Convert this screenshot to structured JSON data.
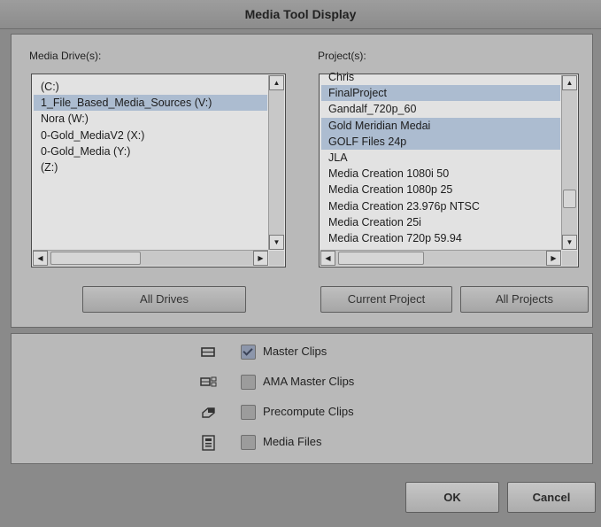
{
  "window": {
    "title": "Media Tool Display"
  },
  "drives": {
    "label": "Media Drive(s):",
    "items": [
      {
        "label": "(C:)",
        "selected": false
      },
      {
        "label": "1_File_Based_Media_Sources (V:)",
        "selected": true
      },
      {
        "label": "Nora (W:)",
        "selected": false
      },
      {
        "label": "0-Gold_MediaV2 (X:)",
        "selected": false
      },
      {
        "label": "0-Gold_Media (Y:)",
        "selected": false
      },
      {
        "label": "(Z:)",
        "selected": false
      }
    ],
    "all_button": "All Drives"
  },
  "projects": {
    "label": "Project(s):",
    "items": [
      {
        "label": "Chris",
        "selected": false
      },
      {
        "label": "FinalProject",
        "selected": true
      },
      {
        "label": "Gandalf_720p_60",
        "selected": false
      },
      {
        "label": "Gold Meridian Medai",
        "selected": true
      },
      {
        "label": "GOLF Files 24p",
        "selected": true
      },
      {
        "label": "JLA",
        "selected": false
      },
      {
        "label": "Media Creation 1080i 50",
        "selected": false
      },
      {
        "label": "Media Creation 1080p 25",
        "selected": false
      },
      {
        "label": "Media Creation 23.976p NTSC",
        "selected": false
      },
      {
        "label": "Media Creation 25i",
        "selected": false
      },
      {
        "label": "Media Creation 720p 59.94",
        "selected": false
      }
    ],
    "current_button": "Current Project",
    "all_button": "All Projects"
  },
  "options": [
    {
      "label": "Master Clips",
      "checked": true,
      "icon": "master-clip-icon"
    },
    {
      "label": "AMA Master Clips",
      "checked": false,
      "icon": "ama-master-clip-icon"
    },
    {
      "label": "Precompute Clips",
      "checked": false,
      "icon": "precompute-clip-icon"
    },
    {
      "label": "Media Files",
      "checked": false,
      "icon": "media-file-icon"
    }
  ],
  "buttons": {
    "ok": "OK",
    "cancel": "Cancel"
  }
}
